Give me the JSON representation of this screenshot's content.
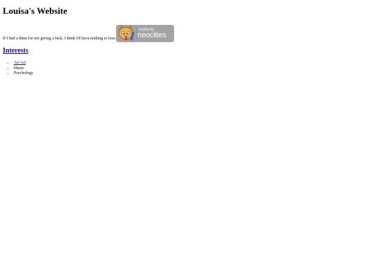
{
  "header": {
    "title": "Louisa's Website"
  },
  "intro": {
    "text": "If I had a dime for not giving a fuck, I think I'd have nothing to lose."
  },
  "badge": {
    "small_text": "hosted by",
    "big_text": "neocities",
    "icon": "neocities-cat-icon",
    "background_color": "#a3a3a3"
  },
  "interests": {
    "heading": "Interests",
    "items": [
      {
        "label": "Art Art",
        "is_link": true
      },
      {
        "label": "Music",
        "is_link": false
      },
      {
        "label": "Psychology",
        "is_link": false
      }
    ]
  },
  "colors": {
    "link": "#0000ee",
    "text": "#000000",
    "background": "#ffffff"
  }
}
